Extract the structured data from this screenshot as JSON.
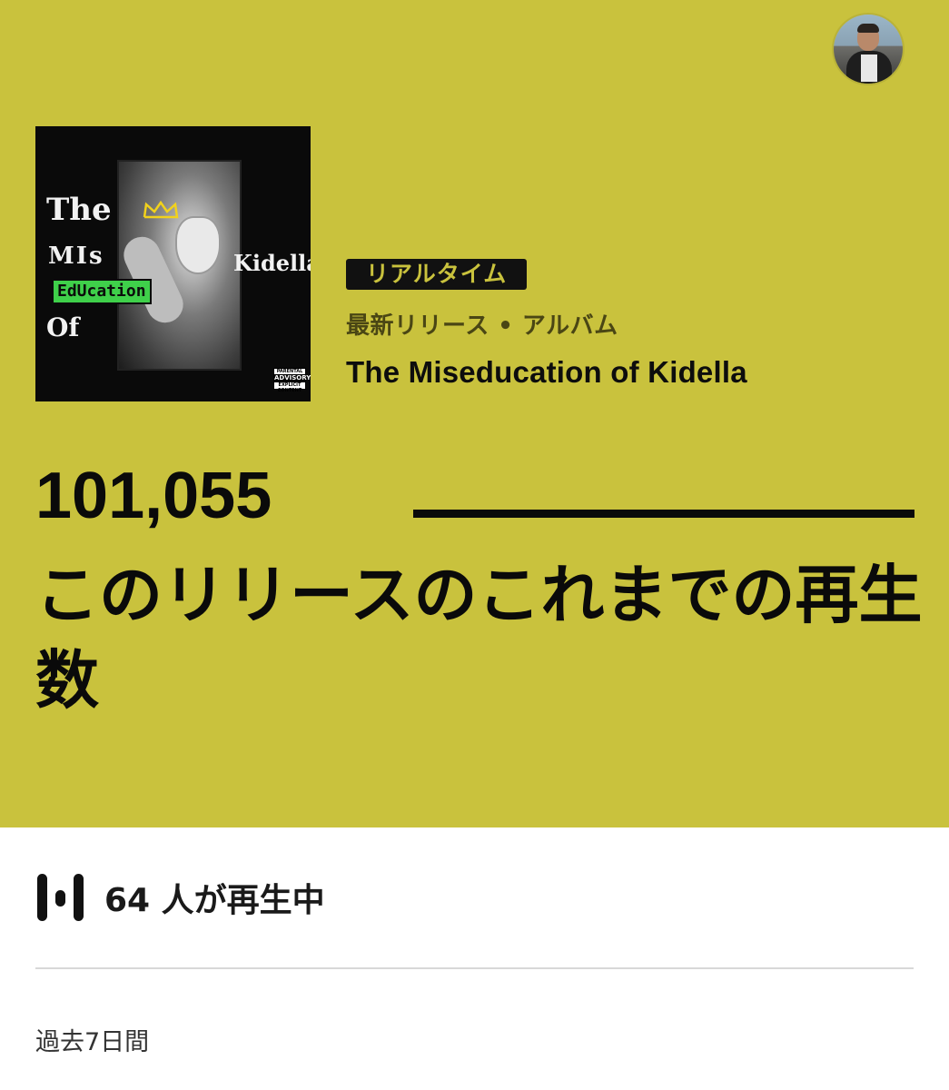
{
  "header": {
    "avatar_icon": "user-avatar"
  },
  "album": {
    "cover_text": {
      "line1": "The",
      "line2": "MIs",
      "line3": "EdUcation",
      "line4": "Of",
      "artist": "Kidella",
      "advisory_top": "PARENTAL",
      "advisory_mid": "ADVISORY",
      "advisory_bottom": "EXPLICIT CONTENT"
    },
    "badge": "リアルタイム",
    "subtitle": "最新リリース • アルバム",
    "title": "The Miseducation of Kidella"
  },
  "stats": {
    "play_count": "101,055",
    "caption": "このリリースのこれまでの再生数",
    "listening_now": "64 人が再生中",
    "period": "過去7日間"
  },
  "colors": {
    "hero_bg": "#c9c23d",
    "badge_bg": "#111111",
    "text_dark": "#0a0a0a"
  }
}
